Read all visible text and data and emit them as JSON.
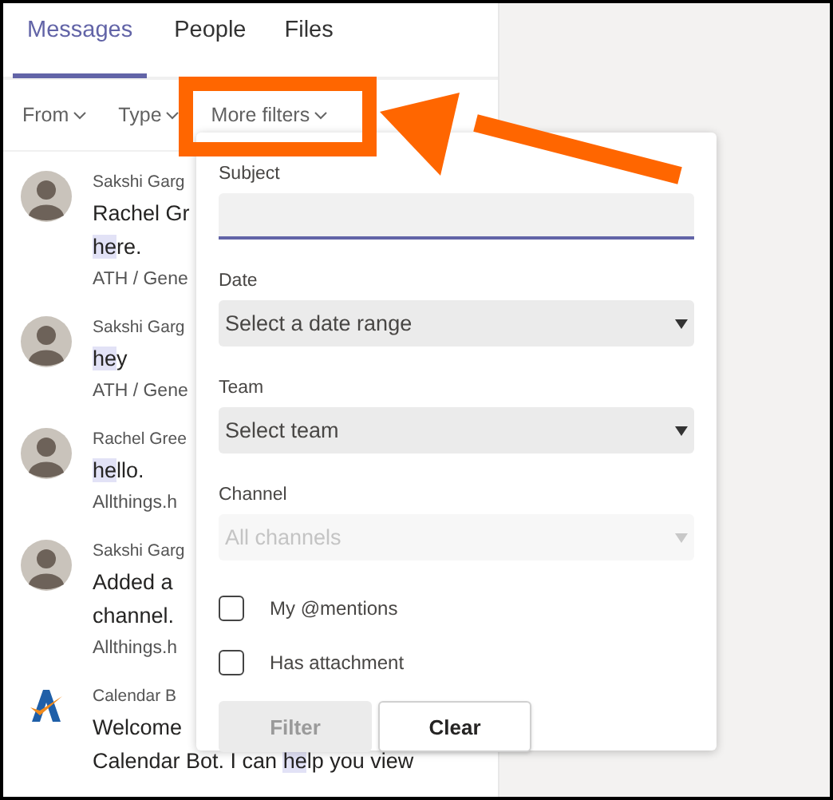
{
  "tabs": [
    {
      "label": "Messages",
      "selected": true
    },
    {
      "label": "People",
      "selected": false
    },
    {
      "label": "Files",
      "selected": false
    }
  ],
  "filters": [
    {
      "label": "From"
    },
    {
      "label": "Type"
    },
    {
      "label": "More filters"
    }
  ],
  "messages": [
    {
      "kind": "person",
      "sender": "Sakshi Garg",
      "lines": [
        [
          {
            "text": "Rachel Gr",
            "highlight": false
          }
        ],
        [
          {
            "text": "he",
            "highlight": true
          },
          {
            "text": "re.",
            "highlight": false
          }
        ]
      ],
      "meta": "ATH / Gene"
    },
    {
      "kind": "person",
      "sender": "Sakshi Garg",
      "lines": [
        [
          {
            "text": "he",
            "highlight": true
          },
          {
            "text": "y",
            "highlight": false
          }
        ]
      ],
      "meta": "ATH / Gene"
    },
    {
      "kind": "person",
      "sender": "Rachel Gree",
      "lines": [
        [
          {
            "text": "he",
            "highlight": true
          },
          {
            "text": "llo.",
            "highlight": false
          }
        ]
      ],
      "meta": "Allthings.h"
    },
    {
      "kind": "person",
      "sender": "Sakshi Garg",
      "lines": [
        [
          {
            "text": "Added a",
            "highlight": false
          }
        ],
        [
          {
            "text": "channel.",
            "highlight": false
          }
        ]
      ],
      "meta": "Allthings.h"
    },
    {
      "kind": "bot",
      "sender": "Calendar B",
      "lines": [
        [
          {
            "text": "Welcome",
            "highlight": false
          }
        ],
        [
          {
            "text": "Calendar Bot. I can ",
            "highlight": false
          },
          {
            "text": "he",
            "highlight": true
          },
          {
            "text": "lp you view",
            "highlight": false
          }
        ]
      ]
    }
  ],
  "more_filters": {
    "fields": [
      {
        "kind": "text",
        "label": "Subject"
      },
      {
        "kind": "select",
        "label": "Date",
        "placeholder": "Select a date range",
        "disabled": false
      },
      {
        "kind": "select",
        "label": "Team",
        "placeholder": "Select team",
        "disabled": false
      },
      {
        "kind": "select",
        "label": "Channel",
        "placeholder": "All channels",
        "disabled": true
      }
    ],
    "checkboxes": [
      {
        "label": "My @mentions",
        "checked": false
      },
      {
        "label": "Has attachment",
        "checked": false
      }
    ],
    "buttons": [
      {
        "label": "Filter",
        "disabled": true
      },
      {
        "label": "Clear",
        "disabled": false
      }
    ]
  }
}
